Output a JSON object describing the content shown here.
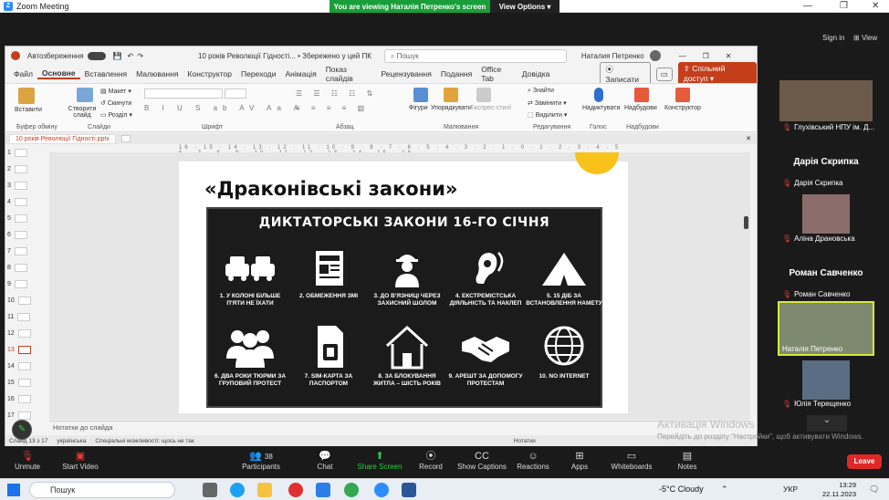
{
  "zoom": {
    "title": "Zoom Meeting",
    "banner": "You are viewing Наталія Петренко's screen",
    "view_options": "View Options",
    "sign_in": "Sign in",
    "view": "View"
  },
  "ppt": {
    "autosave": "Автозбереження",
    "file_title": "10 років Революції Гідності... • Збережено у цей ПК",
    "search": "Пошук",
    "user": "Наталия Петренко",
    "menu": [
      "Файл",
      "Основне",
      "Вставлення",
      "Малювання",
      "Конструктор",
      "Переходи",
      "Анімація",
      "Показ слайдів",
      "Рецензування",
      "Подання",
      "Office Tab",
      "Довідка"
    ],
    "record": "Записати",
    "share": "Спільний доступ",
    "ribbon": {
      "paste": "Вставити",
      "create": "Створити слайд",
      "layout": "Макет",
      "reset": "Скинути",
      "section": "Розділ",
      "clipboard": "Буфер обміну",
      "slides": "Слайди",
      "font": "Шрифт",
      "paragraph": "Абзац",
      "shapes": "Фігури",
      "arrange": "Упорядкувати",
      "styles": "Експрес-стилі",
      "drawing": "Малювання",
      "find": "Знайти",
      "replace": "Замінити",
      "select": "Виділити",
      "editing": "Редагування",
      "dictate": "Надиктувати",
      "voice": "Голос",
      "designer": "Надбудови",
      "addins": "Надбудови",
      "constructor": "Конструктор"
    },
    "tab": "10 років Революції Гідності.pptx",
    "ruler": "16 · 15 · 14 · 13 · 12 · 11 · 10 · 9 · 8 · 7 · 6 · 5 · 4 · 3 · 2 · 1 · 0 · 1 · 2 · 3 · 4 · 5 · 6 · 7 · 8 · 9 · 10 · 11 · 12 · 13 · 14 · 15 · 16",
    "thumbs": [
      "1",
      "2",
      "3",
      "4",
      "5",
      "6",
      "7",
      "8",
      "9",
      "10",
      "11",
      "12",
      "13",
      "14",
      "15",
      "16",
      "17"
    ],
    "selected_slide": "13",
    "slide_title": "«Драконівські закони»",
    "poster_title": "ДИКТАТОРСЬКІ ЗАКОНИ 16-ГО СІЧНЯ",
    "items": [
      "1. У КОЛОНІ БІЛЬШЕ П'ЯТИ НЕ ЇХАТИ",
      "2. ОБМЕЖЕННЯ ЗМІ",
      "3. ДО В'ЯЗНИЦІ ЧЕРЕЗ ЗАХИСНИЙ ШОЛОМ",
      "4. ЕКСТРЕМІСТСЬКА ДІЯЛЬНІСТЬ ТА НАКЛЕП",
      "5. 15 ДІБ ЗА ВСТАНОВЛЕННЯ НАМЕТУ",
      "6. ДВА РОКИ ТЮРМИ ЗА ГРУПОВИЙ ПРОТЕСТ",
      "7. SIM-КАРТА ЗА ПАСПОРТОМ",
      "8. ЗА БЛОКУВАННЯ ЖИТЛА – ШІСТЬ РОКІВ",
      "9. АРЕШТ ЗА ДОПОМОГУ ПРОТЕСТАМ",
      "10. NO INTERNET"
    ],
    "notes": "Нотатки до слайда",
    "status": {
      "slide": "Слайд 13 з 17",
      "lang": "українська",
      "access": "Спеціальні можливості: щось не так",
      "notes": "Нотатки"
    }
  },
  "participants": [
    {
      "name": "Глухівський НПУ ім. Д..."
    },
    {
      "big": "Дарія Скрипка",
      "name": "Дарія Скрипка"
    },
    {
      "name": "Аліна Драновська"
    },
    {
      "big": "Роман Савченко",
      "name": "Роман Савченко"
    },
    {
      "name": "Наталія Петренко"
    },
    {
      "name": "Юлія Терещенко"
    }
  ],
  "toolbar": {
    "unmute": "Unmute",
    "video": "Start Video",
    "participants": "Participants",
    "count": "38",
    "chat": "Chat",
    "share": "Share Screen",
    "record": "Record",
    "captions": "Show Captions",
    "reactions": "Reactions",
    "apps": "Apps",
    "whiteboards": "Whiteboards",
    "notes": "Notes",
    "leave": "Leave"
  },
  "activation": {
    "title": "Активація Windows",
    "sub": "Перейдіть до розділу \"Настройки\", щоб активувати Windows."
  },
  "taskbar": {
    "search": "Пошук",
    "weather": "-5°C  Cloudy",
    "lang": "УКР",
    "time": "13:29",
    "date": "22.11.2023"
  }
}
